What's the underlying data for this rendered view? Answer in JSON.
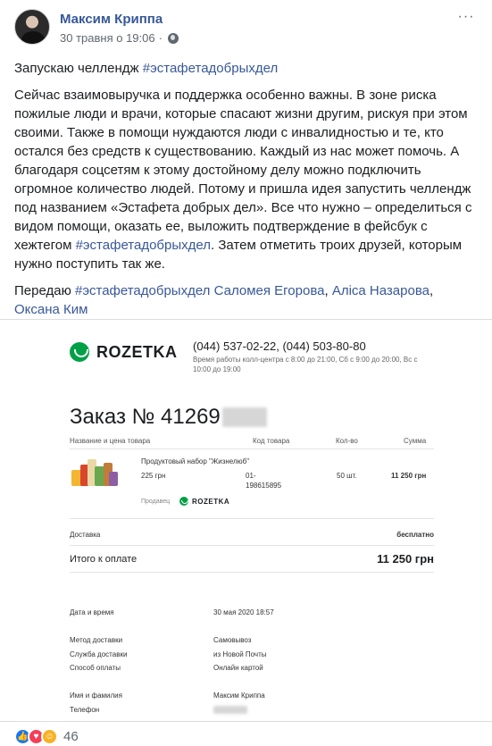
{
  "post": {
    "author": "Максим Криппа",
    "date": "30 травня о 19:06",
    "dot": "·",
    "more": "···",
    "intro": "Запускаю челлендж ",
    "intro_hashtag": "#эстафетадобрыхдел",
    "body_main": "Сейчас взаимовыручка и поддержка особенно важны. В зоне риска пожилые люди и врачи, которые спасают жизни другим, рискуя при этом своими. Также в помощи нуждаются люди с инвалидностью и те, кто остался без средств к существованию. Каждый из нас может помочь. А благодаря соцсетям к этому достойному делу можно подключить огромное количество людей. Потому и пришла идея запустить челлендж под названием «Эстафета добрых дел». Все что нужно – определиться с видом помощи, оказать ее, выложить подтверждение в фейсбук с хежтегом ",
    "body_hashtag": "#эстафетадобрыхдел",
    "body_end": ". Затем отметить троих друзей, которым нужно поступить так же.",
    "pass_prefix": "Передаю ",
    "pass_hashtag": "#эстафетадобрыхдел",
    "mentions": [
      "Саломея Егорова",
      "Аліса Назарова",
      "Оксана Ким"
    ],
    "comma": ", "
  },
  "receipt": {
    "brand": "ROZETKA",
    "phones": "(044) 537-02-22, (044) 503-80-80",
    "hours": "Время работы колл-центра с 8:00 до 21:00, Сб с 9:00 до 20:00, Вс с 10:00 до 19:00",
    "order_title": "Заказ № 41269",
    "headers": {
      "name": "Название и цена товара",
      "code": "Код товара",
      "qty": "Кол-во",
      "sum": "Сумма"
    },
    "item": {
      "name": "Продуктовый набор \"Жизнелюб\"",
      "price": "225 грн",
      "code_line1": "01-",
      "code_line2": "198615895",
      "qty": "50 шт.",
      "sum": "11 250 грн",
      "seller_label": "Продавец"
    },
    "delivery_label": "Доставка",
    "delivery_value": "бесплатно",
    "total_label": "Итого к оплате",
    "total_value": "11 250 грн",
    "info": [
      {
        "label": "Дата и время",
        "value": "30 мая 2020 18:57"
      },
      {
        "label": "Метод доставки",
        "value": "Самовывоз"
      },
      {
        "label": "Служба доставки",
        "value": "из Новой Почты"
      },
      {
        "label": "Способ оплаты",
        "value": "Онлайн картой"
      },
      {
        "label": "Имя и фамилия",
        "value": "Максим Криппа"
      },
      {
        "label": "Телефон",
        "value": ""
      }
    ]
  },
  "reactions": {
    "icons": [
      "like-icon",
      "love-icon",
      "care-icon"
    ],
    "like_glyph": "👍",
    "love_glyph": "♥",
    "care_glyph": "☺",
    "count": "46"
  },
  "colors": {
    "link": "#385898",
    "rozetka_green": "#00a046",
    "like_blue": "#1877f2",
    "love_red": "#f33e58",
    "care_yellow": "#f7b125"
  }
}
